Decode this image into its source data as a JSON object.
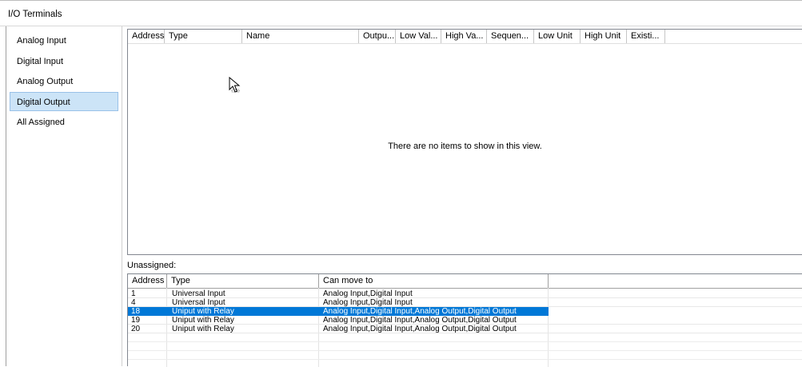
{
  "window": {
    "title": "I/O Terminals"
  },
  "sidebar": {
    "items": [
      {
        "label": "Analog Input",
        "selected": false
      },
      {
        "label": "Digital Input",
        "selected": false
      },
      {
        "label": "Analog Output",
        "selected": false
      },
      {
        "label": "Digital Output",
        "selected": true
      },
      {
        "label": "All Assigned",
        "selected": false
      }
    ]
  },
  "assigned_list": {
    "columns": [
      "Address",
      "Type",
      "Name",
      "Outpu...",
      "Low Val...",
      "High Va...",
      "Sequen...",
      "Low Unit",
      "High Unit",
      "Existi..."
    ],
    "empty_message": "There are no items to show in this view."
  },
  "unassigned": {
    "label": "Unassigned:",
    "columns": [
      "Address",
      "Type",
      "Can move to"
    ],
    "rows": [
      {
        "address": "1",
        "type": "Universal Input",
        "can_move_to": "Analog Input,Digital Input",
        "selected": false
      },
      {
        "address": "4",
        "type": "Universal Input",
        "can_move_to": "Analog Input,Digital Input",
        "selected": false
      },
      {
        "address": "18",
        "type": "Uniput with Relay",
        "can_move_to": "Analog Input,Digital Input,Analog Output,Digital Output",
        "selected": true
      },
      {
        "address": "19",
        "type": "Uniput with Relay",
        "can_move_to": "Analog Input,Digital Input,Analog Output,Digital Output",
        "selected": false
      },
      {
        "address": "20",
        "type": "Uniput with Relay",
        "can_move_to": "Analog Input,Digital Input,Analog Output,Digital Output",
        "selected": false
      }
    ]
  },
  "colors": {
    "selection_blue": "#0078d7",
    "sidebar_selected": "#cce4f7"
  },
  "icons": {
    "cursor": "mouse-pointer-icon"
  }
}
